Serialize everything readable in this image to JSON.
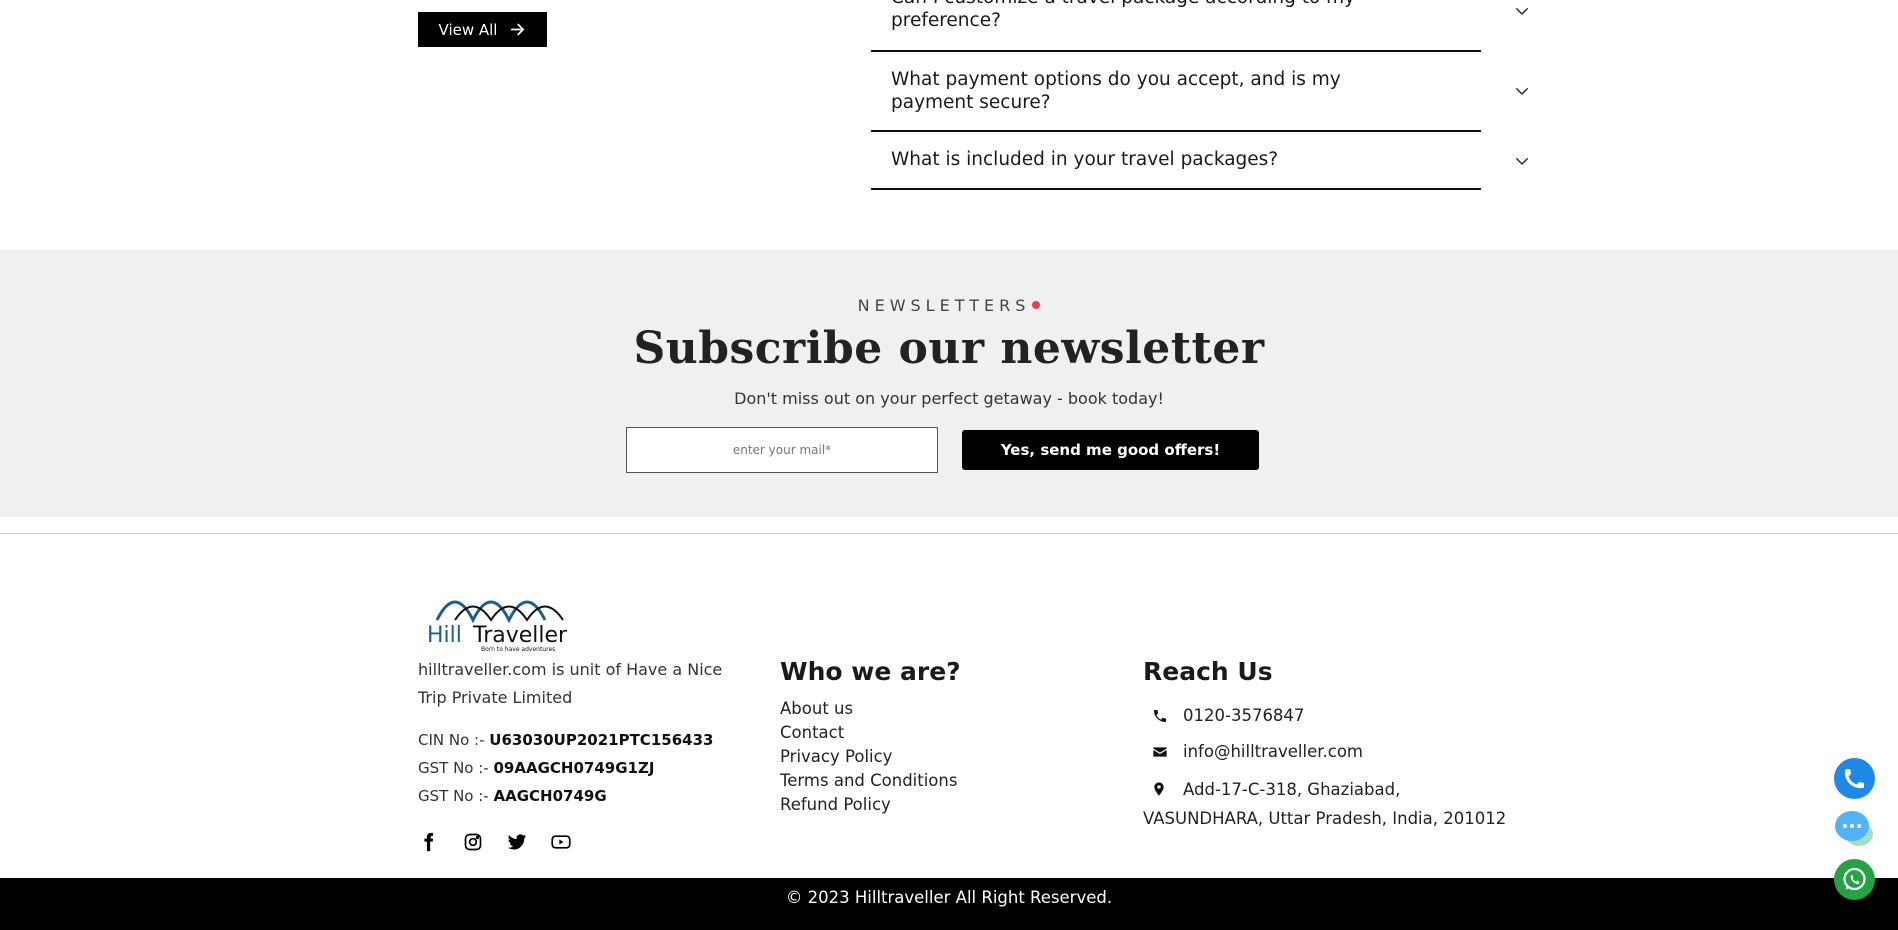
{
  "faq_section": {
    "view_all_label": "View All",
    "questions": [
      "Can I customize a travel package according to my preference?",
      "What payment options do you accept, and is my payment secure?",
      "What is included in your travel packages?"
    ]
  },
  "newsletter": {
    "eyebrow": "NEWSLETTERS",
    "title": "Subscribe our newsletter",
    "subtitle": "Don't miss out on your perfect getaway - book today!",
    "email_placeholder": "enter your mail*",
    "submit_label": "Yes, send me good offers!",
    "accent_color": "#e8404b"
  },
  "footer": {
    "logo": {
      "brand_a": "Hill",
      "brand_b": "Traveller",
      "tagline": "Born to have adventures"
    },
    "about_text": "hilltraveller.com is unit of Have a Nice Trip Private Limited",
    "registration": [
      {
        "label": "CIN No :- ",
        "value": "U63030UP2021PTC156433"
      },
      {
        "label": "GST No :- ",
        "value": "09AAGCH0749G1ZJ"
      },
      {
        "label": "GST No :- ",
        "value": "AAGCH0749G"
      }
    ],
    "socials": [
      "facebook-icon",
      "instagram-icon",
      "twitter-icon",
      "youtube-icon"
    ],
    "who_title": "Who we are?",
    "links": [
      "About us",
      "Contact",
      "Privacy Policy",
      "Terms and Conditions",
      "Refund Policy"
    ],
    "reach_title": "Reach Us",
    "phone": "0120-3576847",
    "email": "info@hilltraveller.com",
    "address": "Add-17-C-318, Ghaziabad, VASUNDHARA, Uttar Pradesh, India, 201012",
    "copyright": "© 2023 Hilltraveller All Right Reserved."
  },
  "floating_buttons": [
    "phone-call-icon",
    "chat-icon",
    "whatsapp-icon"
  ]
}
